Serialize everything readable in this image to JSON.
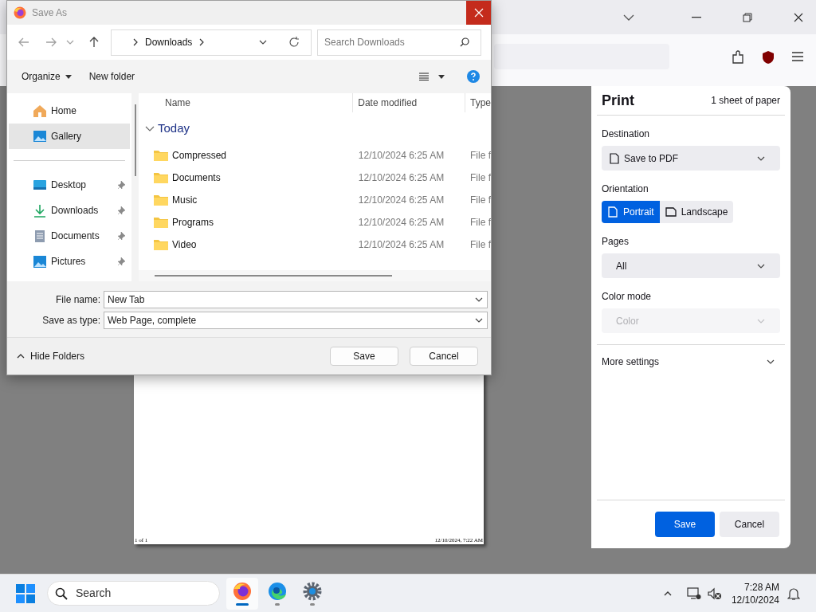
{
  "dialog": {
    "title": "Save As",
    "address": {
      "path": "Downloads"
    },
    "search": {
      "placeholder": "Search Downloads"
    },
    "commands": [
      "Organize",
      "New folder"
    ],
    "nav": [
      {
        "label": "Home",
        "kind": "home",
        "pinned": false,
        "selected": false
      },
      {
        "label": "Gallery",
        "kind": "gallery",
        "pinned": false,
        "selected": true
      },
      {
        "label": "Desktop",
        "kind": "desktop",
        "pinned": true,
        "selected": false
      },
      {
        "label": "Downloads",
        "kind": "downloads",
        "pinned": true,
        "selected": false
      },
      {
        "label": "Documents",
        "kind": "documents",
        "pinned": true,
        "selected": false
      },
      {
        "label": "Pictures",
        "kind": "pictures",
        "pinned": true,
        "selected": false
      }
    ],
    "columns": [
      "Name",
      "Date modified",
      "Type"
    ],
    "group": {
      "label": "Today",
      "expanded": true
    },
    "rows": [
      {
        "name": "Compressed",
        "date": "12/10/2024 6:25 AM",
        "type": "File f"
      },
      {
        "name": "Documents",
        "date": "12/10/2024 6:25 AM",
        "type": "File f"
      },
      {
        "name": "Music",
        "date": "12/10/2024 6:25 AM",
        "type": "File f"
      },
      {
        "name": "Programs",
        "date": "12/10/2024 6:25 AM",
        "type": "File f"
      },
      {
        "name": "Video",
        "date": "12/10/2024 6:25 AM",
        "type": "File f"
      }
    ],
    "file_name": {
      "label": "File name:",
      "value": "New Tab"
    },
    "save_as_type": {
      "label": "Save as type:",
      "value": "Web Page, complete"
    },
    "hide_folders": "Hide Folders",
    "buttons": [
      "Save",
      "Cancel"
    ]
  },
  "preview": {
    "footer_left": "1 of 1",
    "footer_right": "12/10/2024, 7:22 AM"
  },
  "print_panel": {
    "title": "Print",
    "sheets": "1 sheet of paper",
    "destination": {
      "label": "Destination",
      "value": "Save to PDF"
    },
    "orientation": {
      "label": "Orientation",
      "options": [
        {
          "label": "Portrait",
          "selected": true
        },
        {
          "label": "Landscape",
          "selected": false
        }
      ]
    },
    "pages": {
      "label": "Pages",
      "value": "All"
    },
    "color_mode": {
      "label": "Color mode",
      "value": "Color",
      "disabled": true
    },
    "more_settings": "More settings",
    "buttons": [
      "Save",
      "Cancel"
    ]
  },
  "taskbar": {
    "search": {
      "placeholder": "Search"
    },
    "apps": [
      {
        "kind": "firefox",
        "selected": true
      },
      {
        "kind": "edge",
        "selected": false
      },
      {
        "kind": "settings",
        "selected": false
      }
    ],
    "time": "7:28 AM",
    "date": "12/10/2024"
  }
}
